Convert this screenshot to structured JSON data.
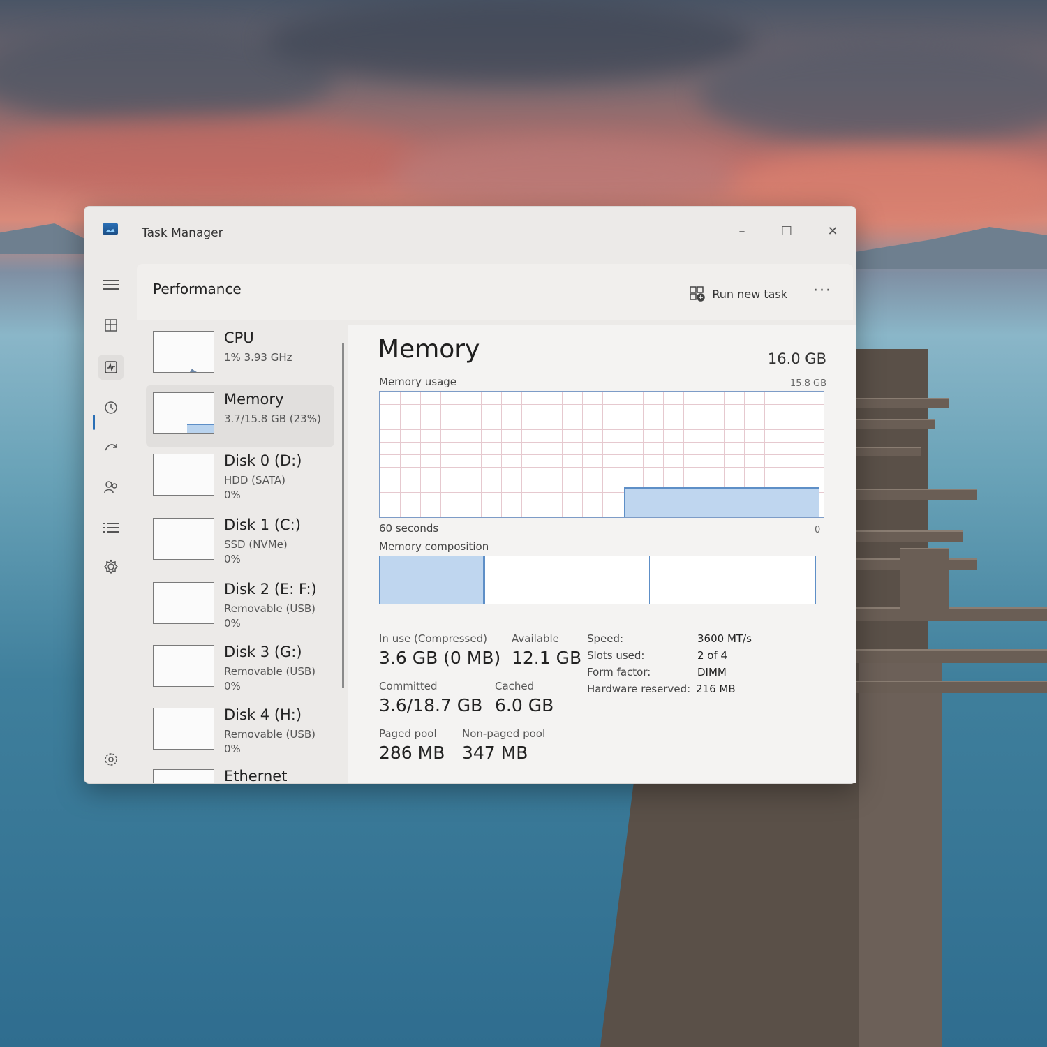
{
  "window": {
    "title": "Task Manager",
    "minimize": "–",
    "maximize": "☐",
    "close": "✕"
  },
  "header": {
    "title": "Performance",
    "run_new_task": "Run new task",
    "more": "···"
  },
  "nav": {
    "icons": [
      "hamburger-icon",
      "processes-icon",
      "performance-icon",
      "app-history-icon",
      "startup-apps-icon",
      "users-icon",
      "details-icon",
      "services-icon",
      "settings-icon"
    ]
  },
  "list": [
    {
      "name": "CPU",
      "line1": "1% 3.93 GHz",
      "line2": ""
    },
    {
      "name": "Memory",
      "line1": "3.7/15.8 GB (23%)",
      "line2": ""
    },
    {
      "name": "Disk 0 (D:)",
      "line1": "HDD (SATA)",
      "line2": "0%"
    },
    {
      "name": "Disk 1 (C:)",
      "line1": "SSD (NVMe)",
      "line2": "0%"
    },
    {
      "name": "Disk 2 (E: F:)",
      "line1": "Removable (USB)",
      "line2": "0%"
    },
    {
      "name": "Disk 3 (G:)",
      "line1": "Removable (USB)",
      "line2": "0%"
    },
    {
      "name": "Disk 4 (H:)",
      "line1": "Removable (USB)",
      "line2": "0%"
    },
    {
      "name": "Ethernet",
      "line1": "",
      "line2": ""
    }
  ],
  "detail": {
    "title": "Memory",
    "total": "16.0 GB",
    "usage_label": "Memory usage",
    "usage_max": "15.8 GB",
    "time_left": "60 seconds",
    "time_right": "0",
    "composition_label": "Memory composition",
    "stats": {
      "in_use_label": "In use (Compressed)",
      "in_use": "3.6 GB (0 MB)",
      "available_label": "Available",
      "available": "12.1 GB",
      "committed_label": "Committed",
      "committed": "3.6/18.7 GB",
      "cached_label": "Cached",
      "cached": "6.0 GB",
      "paged_label": "Paged pool",
      "paged": "286 MB",
      "nonpaged_label": "Non-paged pool",
      "nonpaged": "347 MB"
    },
    "specs": {
      "speed_label": "Speed:",
      "speed": "3600 MT/s",
      "slots_label": "Slots used:",
      "slots": "2 of 4",
      "form_label": "Form factor:",
      "form": "DIMM",
      "hw_label": "Hardware reserved:",
      "hw": "216 MB"
    }
  },
  "colors": {
    "accent": "#2a6fb5",
    "graph_line": "#5e8fc7",
    "graph_fill": "#bfd6ef"
  }
}
